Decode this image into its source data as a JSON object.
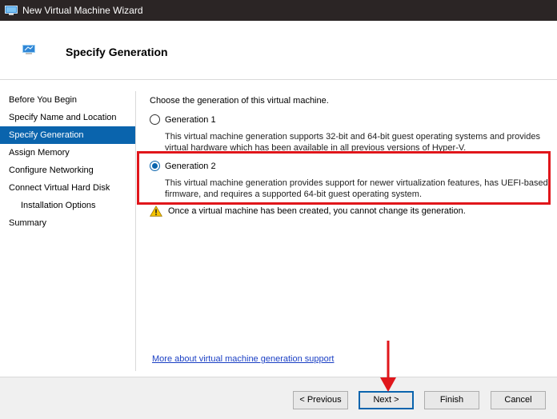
{
  "window": {
    "title": "New Virtual Machine Wizard"
  },
  "header": {
    "title": "Specify Generation"
  },
  "sidebar": {
    "items": [
      {
        "label": "Before You Begin"
      },
      {
        "label": "Specify Name and Location"
      },
      {
        "label": "Specify Generation"
      },
      {
        "label": "Assign Memory"
      },
      {
        "label": "Configure Networking"
      },
      {
        "label": "Connect Virtual Hard Disk"
      },
      {
        "label": "Installation Options"
      },
      {
        "label": "Summary"
      }
    ],
    "selected_index": 2
  },
  "main": {
    "intro": "Choose the generation of this virtual machine.",
    "options": [
      {
        "label": "Generation 1",
        "selected": false,
        "description_line1": "This virtual machine generation supports 32-bit and 64-bit guest operating systems and provides",
        "description_line2": "virtual hardware which has been available in all previous versions of Hyper-V."
      },
      {
        "label": "Generation 2",
        "selected": true,
        "description_line1": "This virtual machine generation provides support for newer virtualization features, has UEFI-based",
        "description_line2": "firmware, and requires a supported 64-bit guest operating system."
      }
    ],
    "warning": "Once a virtual machine has been created, you cannot change its generation.",
    "more_link": "More about virtual machine generation support"
  },
  "buttons": {
    "previous": "< Previous",
    "next": "Next >",
    "finish": "Finish",
    "cancel": "Cancel"
  },
  "colors": {
    "accent": "#0a64ad",
    "highlight": "#e0161b",
    "titlebar": "#2b2525"
  }
}
